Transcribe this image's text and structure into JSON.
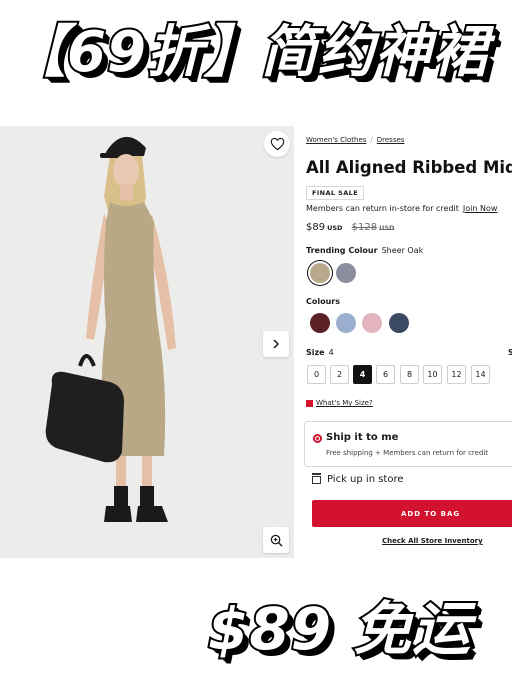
{
  "banner_top": "【69折】简约神裙",
  "banner_bottom": "$89 免运",
  "gallery": {
    "wishlist_icon": "heart-icon",
    "next_icon": "chevron-right-icon",
    "zoom_icon": "zoom-in-icon"
  },
  "breadcrumb": [
    "Women's Clothes",
    "Dresses"
  ],
  "product": {
    "title": "All Aligned Ribbed Midi Dress",
    "badge": "FINAL SALE",
    "members_text": "Members can return in-store for credit",
    "join_link": "Join Now",
    "price": "$89",
    "currency": "USD",
    "original_price": "$128",
    "trending_label": "Trending Colour",
    "trending_value": "Sheer Oak",
    "trending_swatches": [
      "#b8a88c",
      "#8b8e9e"
    ],
    "colours_label": "Colours",
    "colour_swatches": [
      "#5a2127",
      "#9caed0",
      "#e3b4bd",
      "#3a4a63"
    ],
    "size_label": "Size",
    "size_value": "4",
    "size_right_label": "S",
    "sizes": [
      "0",
      "2",
      "4",
      "6",
      "8",
      "10",
      "12",
      "14"
    ],
    "selected_size": "4",
    "fit_link": "What's My Size?"
  },
  "shipping": {
    "ship_title": "Ship it to me",
    "ship_sub": "Free shipping + Members can return for credit",
    "pickup_label": "Pick up in store",
    "add_to_bag": "ADD TO BAG",
    "check_inventory": "Check All Store Inventory"
  },
  "colors": {
    "brand_red": "#d2122e",
    "photo_bg": "#ececea",
    "dress": "#b9a886"
  }
}
